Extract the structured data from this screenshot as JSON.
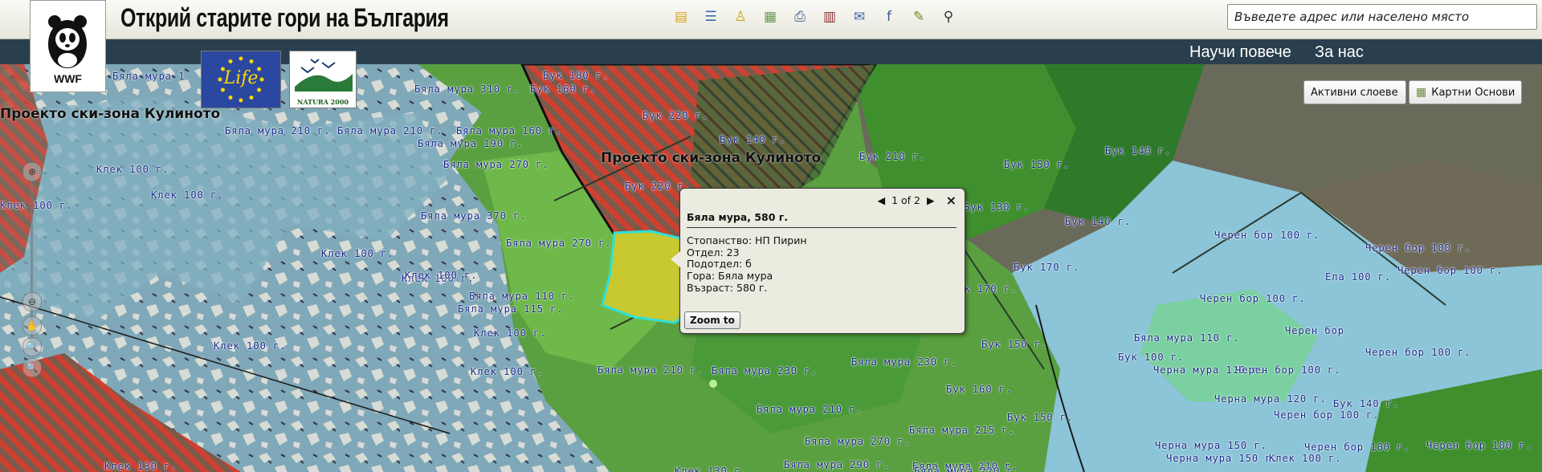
{
  "header": {
    "title": "Открий старите гори на България",
    "search_placeholder": "Въведете адрес или населено място",
    "tools": [
      {
        "name": "layers-icon",
        "glyph": "▤",
        "color": "#d8a020"
      },
      {
        "name": "legend-icon",
        "glyph": "☰",
        "color": "#3a6ab0"
      },
      {
        "name": "identify-icon",
        "glyph": "♙",
        "color": "#c8a010"
      },
      {
        "name": "map-overview-icon",
        "glyph": "▦",
        "color": "#6a9a50"
      },
      {
        "name": "print-icon",
        "glyph": "⎙",
        "color": "#4a6a9a"
      },
      {
        "name": "bookmark-icon",
        "glyph": "▥",
        "color": "#8a3030"
      },
      {
        "name": "email-icon",
        "glyph": "✉",
        "color": "#3a6ab0"
      },
      {
        "name": "facebook-icon",
        "glyph": "f",
        "color": "#3b5998"
      },
      {
        "name": "edit-icon",
        "glyph": "✎",
        "color": "#6a8a20"
      },
      {
        "name": "binoculars-icon",
        "glyph": "⚲",
        "color": "#333"
      }
    ]
  },
  "nav": {
    "learn_more": "Научи повече",
    "about": "За нас"
  },
  "logos": {
    "wwf": "WWF",
    "life": "Life",
    "natura": "NATURA 2000"
  },
  "map": {
    "active_layers": "Активни слоеве",
    "basemaps": "Картни Основи",
    "zone_label": "Проекто ски-зона Кулиното",
    "labels": [
      "Бяла мура 1",
      "Бяла мура 310 г.",
      "Бук 180 г.",
      "Бук 160 г.",
      "Бяла мура 210 г.",
      "Бяла мура 210 г.",
      "Бяла мура 160 г.",
      "Бяла мура 190 г.",
      "Бук 220 г.",
      "Бук 140 г.",
      "Бяла мура 270 г.",
      "Бук 210 г.",
      "Бук 150 г.",
      "Бук 140 г.",
      "Клек 100 г.",
      "Клек 100 г.",
      "Клек 100 г.",
      "Бук 220 г.",
      "Бук 130 г.",
      "Бук 140 г.",
      "Бяла мура 370 г.",
      "Клек 100 г.",
      "Бяла мура 270 г.",
      "Черен бор 100 г.",
      "Черен бор 100 г.",
      "Клек 100 г.",
      "Клек 100 г.",
      "Бук 170 г.",
      "Ела 100 г.",
      "Черен бор 100 г.",
      "Бяла мура 110 г.",
      "Бук 170 г.",
      "Черен бор 100 г.",
      "Бяла мура 115 г.",
      "Клек 100 г.",
      "Бяла мура 110 г.",
      "Черен бор",
      "Бук 150 г.",
      "Черен бор 100 г.",
      "Клек 100 г.",
      "Бяла мура 230 г.",
      "Бук 100 г.",
      "Бяла мура 210 г.",
      "Бяла мура 230 г.",
      "Клек 100 г.",
      "Черна мура 110 г.",
      "Черен бор 100 г.",
      "Бук 160 г.",
      "Черна мура 120 г.",
      "Бук 140 г.",
      "Бяла мура 210 г.",
      "Бук 150 г.",
      "Черен бор 100 г.",
      "Бяла мура 215 г.",
      "Бяла мура 270 г.",
      "Черна мура 150 г.",
      "Черен бор 100 г.",
      "Клек 130 г.",
      "Черна мура 150 г.",
      "Бяла мура 290 г.",
      "Бяла мура 210 г.",
      "Черен бор 100 г.",
      "Клек 100 г.",
      "Клек 130 г.",
      "Бяла мура 220 г."
    ]
  },
  "popup": {
    "pager": "1 of 2",
    "prev": "◀",
    "next": "▶",
    "close": "×",
    "title": "Бяла мура, 580 г.",
    "fields": [
      "Стопанство: НП Пирин",
      "Отдел: 23",
      "Подотдел: б",
      "Гора: Бяла мура",
      "Възраст: 580 г."
    ],
    "zoom_to": "Zoom to"
  },
  "zoom_controls": [
    "⊖",
    "✋",
    "🔍",
    "🔍"
  ]
}
